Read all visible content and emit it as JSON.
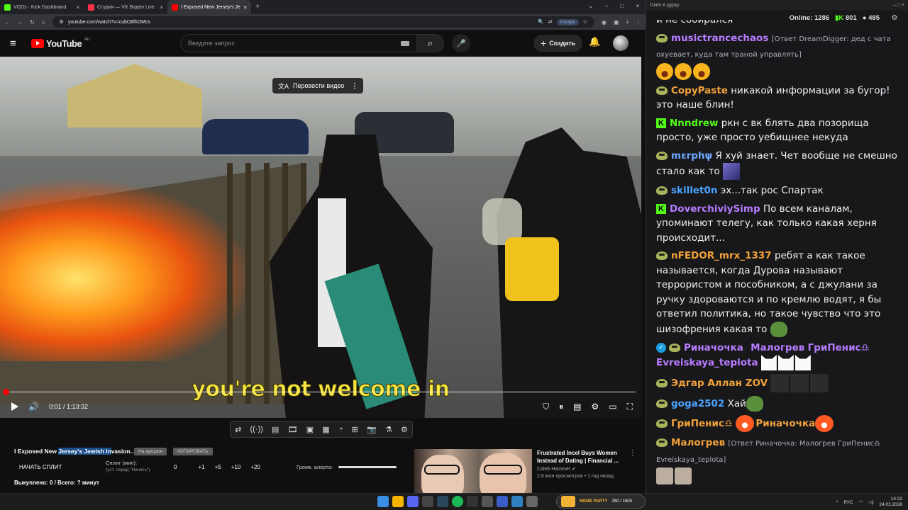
{
  "browser": {
    "tabs": [
      {
        "title": "VODs - Kick Dashboard",
        "color": "#53fc18"
      },
      {
        "title": "Студия — VK Видео Live",
        "color": "#ff3347"
      },
      {
        "title": "I Exposed New Jersey's Jewish I",
        "color": "#ff0000"
      }
    ],
    "url": "youtube.com/watch?v=cubO8lhOMcs",
    "google_label": "Google"
  },
  "youtube": {
    "logo_text": "YouTube",
    "region": "RU",
    "search_placeholder": "Введите запрос",
    "create_label": "Создать"
  },
  "player": {
    "translate_label": "Перевести видео",
    "subtitle": "you're not welcome in",
    "time": "0:01 / 1:13:32",
    "progress_fraction": 0.0002
  },
  "below": {
    "title_pre": "I Exposed New ",
    "title_hl": "Jersey's Jewish In",
    "title_post": "vasion...",
    "btn_auction": "На аукцион",
    "btn_copy": "КОПИРОВАТЬ",
    "split_start": "НАЧАТЬ СПЛИТ",
    "split_min_label": "Сплит (мин):",
    "split_min_hint": "(уст. перед \"Начать\")",
    "split_value": "0",
    "increments": [
      "+1",
      "+5",
      "+10",
      "+20"
    ],
    "alert_label": "Громк. алерта:",
    "bought": "Выкуплено: 0 / Всего: ? минут"
  },
  "recommendation": {
    "title": "Frustrated Incel Buys Women Instead of Dating | Financial ...",
    "channel": "Caleb Hammer",
    "meta": "2,6 млн просмотров • 1 год назад"
  },
  "chat": {
    "window_title": "Окно в дурку",
    "online_label": "Online:",
    "online_count": "1286",
    "kick_count": "801",
    "other_count": "485",
    "messages": [
      {
        "nick": "",
        "text": "и не собирался"
      },
      {
        "nick": "musictrancechaos",
        "reply": "[Ответ DreamDigger: дед с чата охуевает, куда там траной управлять]",
        "text": ""
      },
      {
        "nick": "CopyPaste",
        "text": "никакой информации за бугор! это наше блин!"
      },
      {
        "nick": "Nnndrew",
        "text": "ркн с вк блять два позорища просто, уже просто уебищнее некуда"
      },
      {
        "nick": "mεrphψ",
        "text": "Я хуй знает. Чет вообще не смешно стало как то"
      },
      {
        "nick": "skillet0n",
        "text": "эх...так рос Спартак"
      },
      {
        "nick": "DoverchiviySimp",
        "text": "По всем каналам, упоминают телегу, как только какая херня происходит..."
      },
      {
        "nick": "nFEDOR_mrx_1337",
        "text": "ребят а как такое называется, когда Дурова называют террористом и пособником, а с джулани за ручку здороваются и по кремлю водят, я бы ответил политика, но такое чувство что это шизофрения какая то"
      },
      {
        "nick": "Риначочка",
        "mentions": [
          "Малогрев",
          "ГриПенис♎",
          "Evreiskaya_teplota"
        ],
        "text": ""
      },
      {
        "nick": "Эдгар Аллан ZOV",
        "text": ""
      },
      {
        "nick": "goga2502",
        "text": "Хай"
      },
      {
        "nick": "ГриПенис♎",
        "mention": "Риначочка",
        "text": ""
      },
      {
        "nick": "Малогрев",
        "reply": "[Ответ Риначочка: Малогрев ГриПенис♎ Evreiskaya_teplota]",
        "text": ""
      }
    ]
  },
  "taskbar": {
    "meme_label": "MEME PARTY",
    "meme_count": "250 / 1500",
    "lang": "РУС",
    "time": "14:22",
    "date": "24.02.2026"
  },
  "colors": {
    "youtube_red": "#ff0000",
    "kick_green": "#53fc18",
    "subtitle_yellow": "#f7e641",
    "nick_purple": "#b77cff",
    "nick_orange": "#f2a23a",
    "nick_green": "#53fc18",
    "nick_blue": "#4aa3ff"
  }
}
